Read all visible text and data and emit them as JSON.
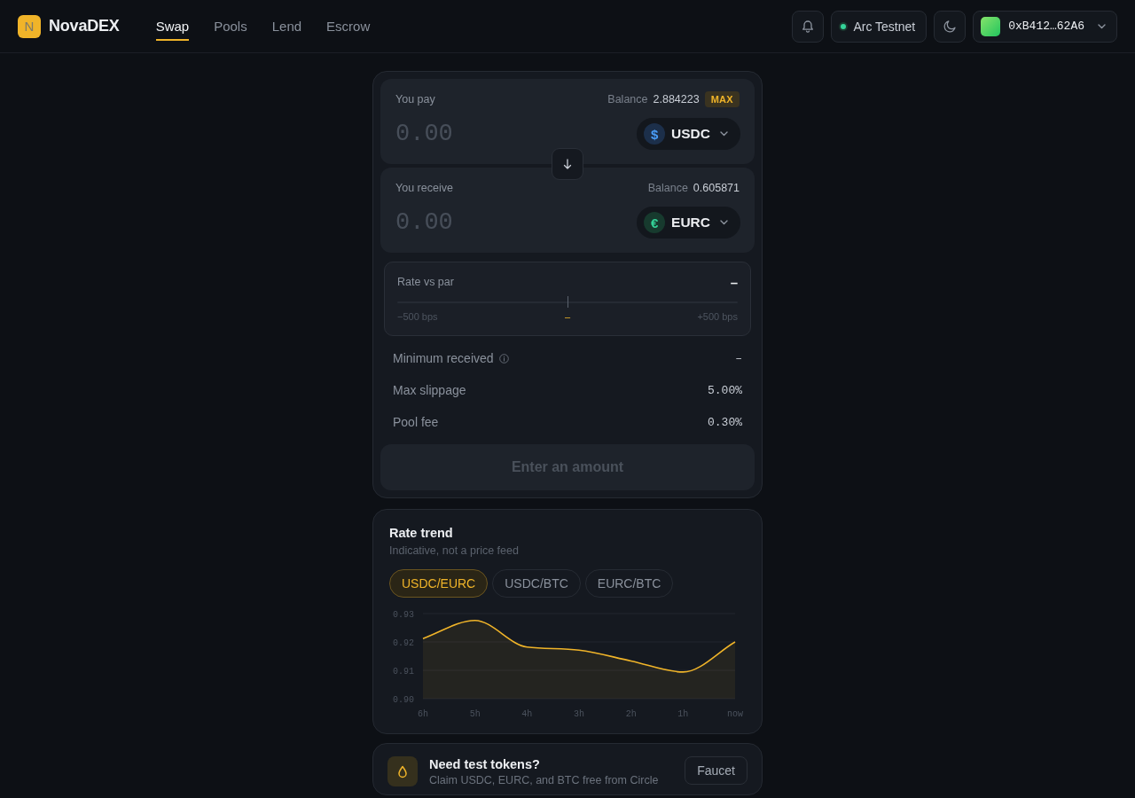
{
  "header": {
    "logo_letter": "N",
    "brand": "NovaDEX",
    "nav": [
      {
        "label": "Swap",
        "selected": true
      },
      {
        "label": "Pools",
        "selected": false
      },
      {
        "label": "Lend",
        "selected": false
      },
      {
        "label": "Escrow",
        "selected": false
      }
    ],
    "network": "Arc Testnet",
    "wallet": "0xB412…62A6"
  },
  "swap": {
    "panels": [
      {
        "label": "You pay",
        "balance_label": "Balance",
        "balance": "2.884223",
        "max": "MAX",
        "placeholder": "0.00",
        "token": {
          "symbol": "USDC",
          "icon": "$",
          "kind": "usd"
        }
      },
      {
        "label": "You receive",
        "balance_label": "Balance",
        "balance": "0.605871",
        "placeholder": "0.00",
        "token": {
          "symbol": "EURC",
          "icon": "€",
          "kind": "eur"
        }
      }
    ],
    "rate": {
      "label": "Rate vs par",
      "value": "–",
      "scale_min": "−500 bps",
      "reading": "–",
      "scale_max": "+500 bps"
    },
    "details": [
      {
        "label": "Minimum received",
        "info": true,
        "value": "–"
      },
      {
        "label": "Max slippage",
        "info": false,
        "value": "5.00%"
      },
      {
        "label": "Pool fee",
        "info": false,
        "value": "0.30%"
      }
    ],
    "submit": {
      "label": "Enter an amount",
      "disabled": true
    }
  },
  "rate_trend": {
    "title": "Rate trend",
    "subtitle": "Indicative, not a price feed",
    "pairs": [
      {
        "label": "USDC/EURC",
        "selected": true
      },
      {
        "label": "USDC/BTC",
        "selected": false
      },
      {
        "label": "EURC/BTC",
        "selected": false
      }
    ],
    "chart_data": {
      "type": "area",
      "categories": [
        "6h",
        "5h",
        "4h",
        "3h",
        "2h",
        "1h",
        "now"
      ],
      "series": [
        {
          "color": "#f0b429",
          "values": [
            0.9212,
            0.9276,
            0.9182,
            0.9171,
            0.9133,
            0.9094,
            0.92
          ]
        }
      ],
      "ylim": [
        0.9,
        0.93
      ],
      "yticks": [
        {
          "value": 0.9,
          "label": "0.90"
        },
        {
          "value": 0.91,
          "label": "0.91"
        },
        {
          "value": 0.92,
          "label": "0.92"
        },
        {
          "value": 0.93,
          "label": "0.93"
        }
      ]
    }
  },
  "faucet": {
    "title": "Need test tokens?",
    "subtitle": "Claim USDC, EURC, and BTC free from Circle",
    "button": "Faucet"
  }
}
